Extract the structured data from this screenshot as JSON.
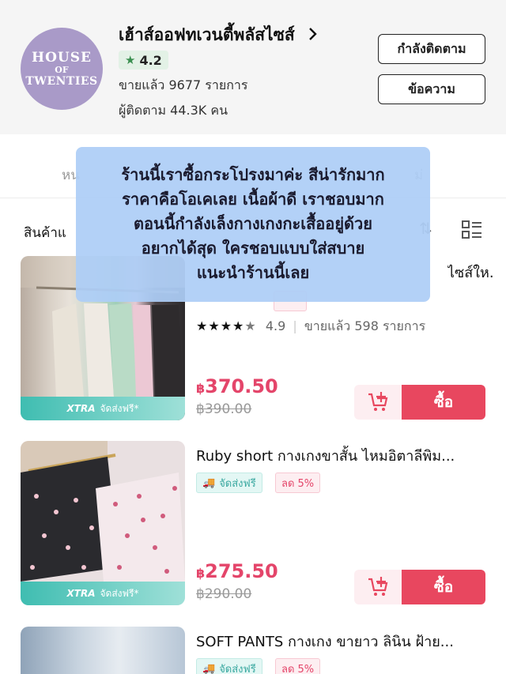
{
  "shop": {
    "logo_line1": "HOUSE",
    "logo_line2": "OF",
    "logo_line3": "TWENTIES",
    "name": "เฮ้าส์ออฟทเวนตี้พลัสไซส์",
    "rating": "4.2",
    "sold": "ขายแล้ว 9677 รายการ",
    "followers": "ผู้ติดตาม 44.3K คน",
    "follow_label": "กำลังติดตาม",
    "message_label": "ข้อความ"
  },
  "tabs": {
    "left": "หน",
    "right": "ม่"
  },
  "filter": {
    "label": "สินค้าแ"
  },
  "caption_lines": [
    "ร้านนี้เราซื้อกระโปรงมาค่ะ สีน่ารักมาก",
    "ราคาคือโอเคเลย เนื้อผ้าดี เราชอบมาก",
    "ตอนนี้กำลังเล็งกางเกงกะเสื้ออยู่ด้วย",
    "อยากได้สุด ใครชอบแบบใส่สบาย",
    "แนะนำร้านนี้เลย"
  ],
  "products": [
    {
      "title_fragment": "ไซส์ให...",
      "rating": "4.9",
      "stars": 4.5,
      "sold": "ขายแล้ว 598 รายการ",
      "price": "370.50",
      "old_price": "฿390.00",
      "strip_brand": "XTRA",
      "strip_text": "จัดส่งฟรี*",
      "buy_label": "ซื้อ"
    },
    {
      "title": "Ruby short กางเกงขาสั้น ไหมอิตาลีพิม...",
      "ship_badge": "จัดส่งฟรี",
      "discount_badge": "ลด 5%",
      "price": "275.50",
      "old_price": "฿290.00",
      "strip_brand": "XTRA",
      "strip_text": "จัดส่งฟรี*",
      "buy_label": "ซื้อ"
    },
    {
      "title": "SOFT PANTS กางเกง ขายาว ลินิน ฝ้าย...",
      "ship_badge": "จัดส่งฟรี",
      "discount_badge": "ลด 5%"
    }
  ],
  "currency_symbol": "฿",
  "colors": {
    "accent": "#e8475f",
    "price": "#e4456a",
    "logo": "#a99ac8",
    "caption_bg": "#adcdf6"
  }
}
